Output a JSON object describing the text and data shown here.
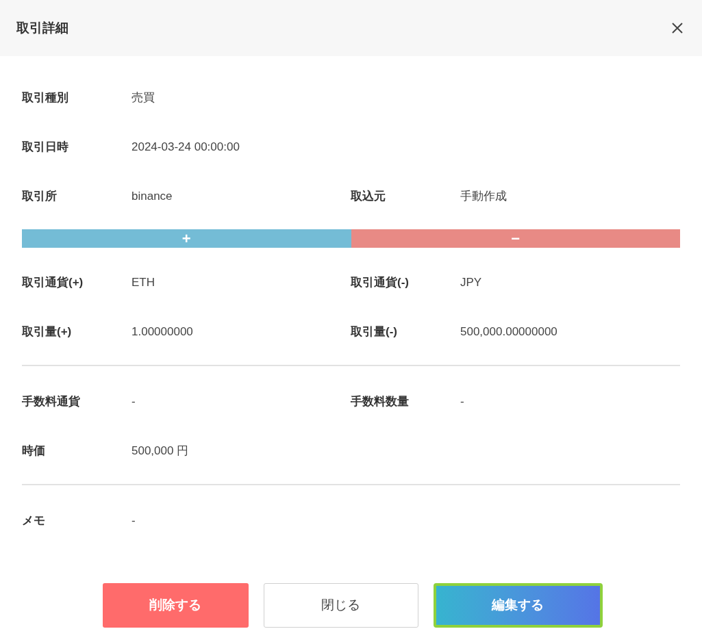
{
  "header": {
    "title": "取引詳細"
  },
  "blocks": [
    {
      "kind": "fields",
      "rows": [
        [
          {
            "label": "取引種別",
            "value": "売買"
          }
        ],
        [
          {
            "label": "取引日時",
            "value": "2024-03-24 00:00:00"
          }
        ],
        [
          {
            "label": "取引所",
            "value": "binance"
          },
          {
            "label": "取込元",
            "value": "手動作成"
          }
        ]
      ]
    },
    {
      "kind": "bar",
      "segments": [
        {
          "label": "+",
          "color": "#74bcd6"
        },
        {
          "label": "−",
          "color": "#e88a85"
        }
      ]
    },
    {
      "kind": "fields",
      "rows": [
        [
          {
            "label": "取引通貨(+)",
            "value": "ETH"
          },
          {
            "label": "取引通貨(-)",
            "value": "JPY"
          }
        ],
        [
          {
            "label": "取引量(+)",
            "value": "1.00000000"
          },
          {
            "label": "取引量(-)",
            "value": "500,000.00000000"
          }
        ]
      ]
    },
    {
      "kind": "divider"
    },
    {
      "kind": "fields",
      "rows": [
        [
          {
            "label": "手数料通貨",
            "value": "-"
          },
          {
            "label": "手数料数量",
            "value": "-"
          }
        ],
        [
          {
            "label": "時価",
            "value": "500,000 円"
          }
        ]
      ]
    },
    {
      "kind": "divider"
    },
    {
      "kind": "fields",
      "rows": [
        [
          {
            "label": "メモ",
            "value": "-"
          }
        ]
      ]
    }
  ],
  "buttons": [
    {
      "kind": "danger",
      "label": "削除する"
    },
    {
      "kind": "plain",
      "label": "閉じる"
    },
    {
      "kind": "primary",
      "label": "編集する",
      "focused": true
    }
  ]
}
